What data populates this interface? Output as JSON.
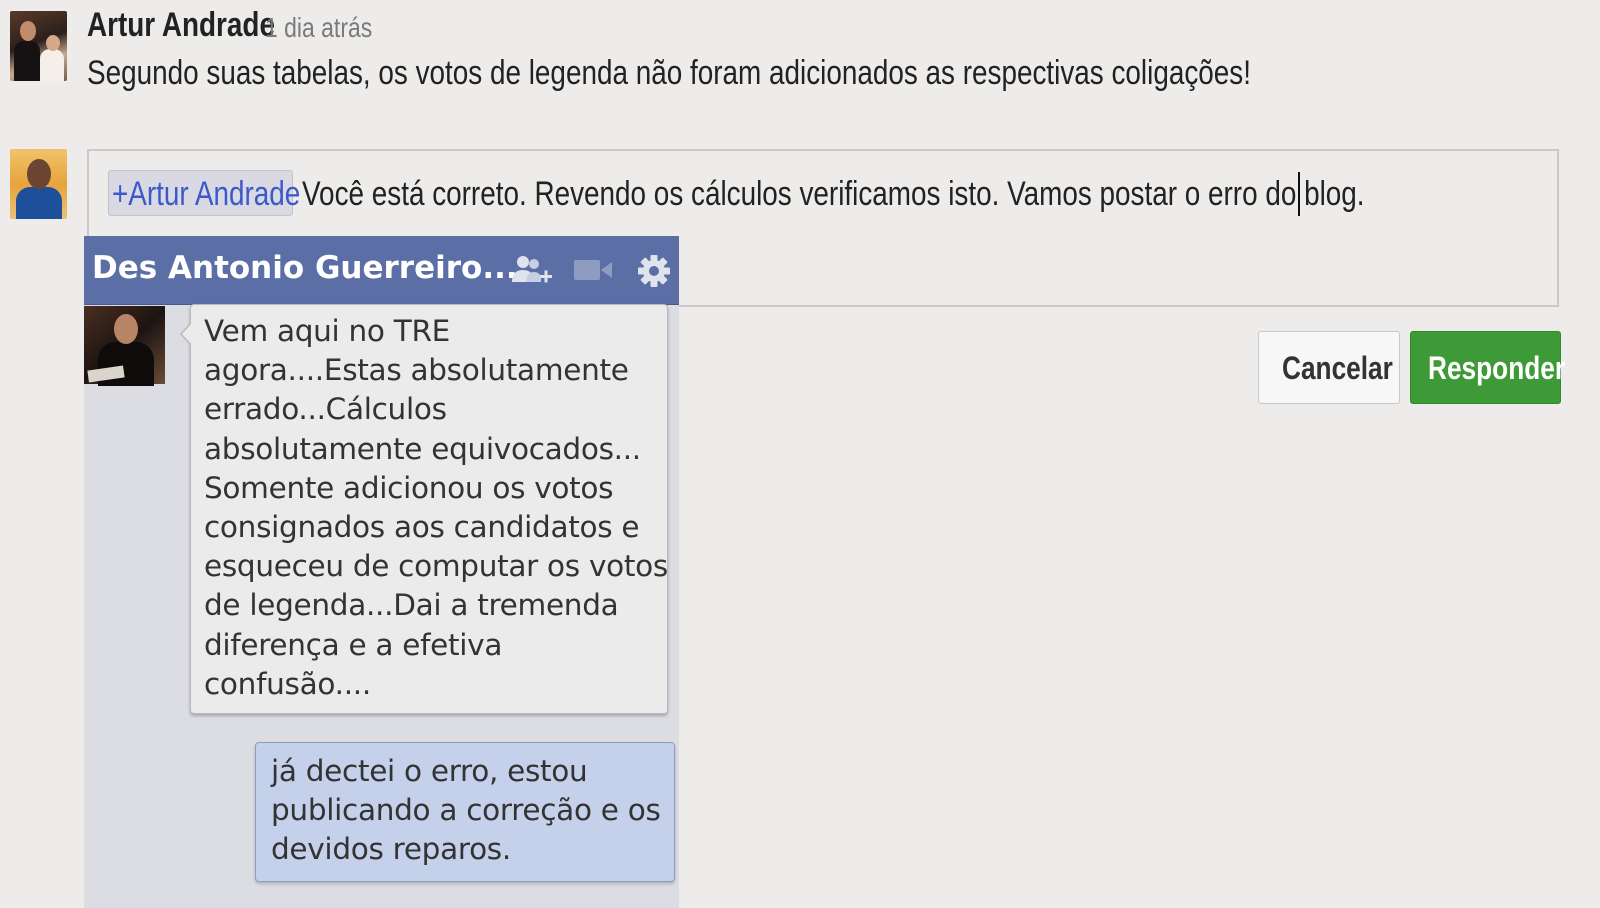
{
  "comment": {
    "author": "Artur Andrade",
    "time": "1 dia atrás",
    "text": "Segundo suas tabelas, os votos de legenda não foram adicionados as respectivas coligações!"
  },
  "reply": {
    "mention": "+Artur Andrade",
    "text": "Você está correto. Revendo os cálculos verificamos isto. Vamos postar o erro do blog.",
    "cancel_label": "Cancelar",
    "submit_label": "Responder"
  },
  "chat": {
    "title": "Des Antonio Guerreiro...",
    "icons": [
      "add-friend-icon",
      "video-camera-icon",
      "gear-icon"
    ],
    "messages": [
      {
        "direction": "incoming",
        "text": "Vem aqui no TRE\nagora....Estas absolutamente\nerrado...Cálculos\nabsolutamente equivocados...\nSomente adicionou os votos\nconsignados aos candidatos e\nesqueceu de computar os votos\nde legenda...Dai a tremenda\ndiferença e a efetiva\nconfusão...."
      },
      {
        "direction": "outgoing",
        "text": "já dectei o erro, estou\npublicando a correção e os\ndevidos reparos."
      }
    ]
  },
  "colors": {
    "background": "#eeecea",
    "mention": "#3b59c8",
    "chat_header": "#5b6ea5",
    "submit_button": "#3d9a37",
    "outgoing_bubble": "#c5d0ea"
  }
}
